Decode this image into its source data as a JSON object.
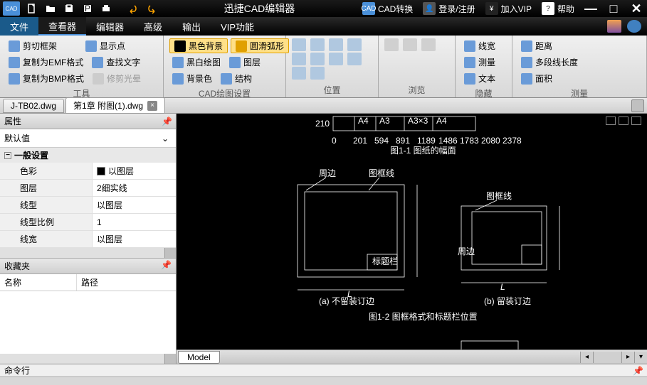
{
  "titlebar": {
    "app_title": "迅捷CAD编辑器",
    "cad_convert": "CAD转换",
    "login": "登录/注册",
    "vip": "加入VIP",
    "help": "帮助"
  },
  "menu": {
    "file": "文件",
    "viewer": "查看器",
    "editor": "编辑器",
    "advanced": "高级",
    "output": "输出",
    "vip_fn": "VIP功能"
  },
  "ribbon": {
    "tools": {
      "clip_frame": "剪切框架",
      "copy_emf": "复制为EMF格式",
      "copy_bmp": "复制为BMP格式",
      "show_points": "显示点",
      "find_text": "查找文字",
      "repair_halo": "修剪光晕",
      "label": "工具"
    },
    "cad_draw": {
      "black_bg": "黑色背景",
      "smooth_arc": "圆滑弧形",
      "bw_draw": "黑白绘图",
      "layers": "图层",
      "bg_color": "背景色",
      "structure": "结构",
      "label": "CAD绘图设置"
    },
    "position": {
      "label": "位置"
    },
    "browse": {
      "label": "浏览"
    },
    "hide": {
      "linewidth": "线宽",
      "measure": "测量",
      "text": "文本",
      "label": "隐藏"
    },
    "measure": {
      "distance": "距离",
      "polyline_len": "多段线长度",
      "area": "面积",
      "label": "测量"
    }
  },
  "doctabs": {
    "tab1": "J-TB02.dwg",
    "tab2": "第1章 附图(1).dwg"
  },
  "props": {
    "title": "属性",
    "default_val": "默认值",
    "general": "一般设置",
    "color_k": "色彩",
    "color_v": "以图层",
    "layer_k": "图层",
    "layer_v": "2细实线",
    "linetype_k": "线型",
    "linetype_v": "以图层",
    "scale_k": "线型比例",
    "scale_v": "1",
    "lw_k": "线宽",
    "lw_v": "以图层"
  },
  "fav": {
    "title": "收藏夹",
    "col_name": "名称",
    "col_path": "路径"
  },
  "canvas": {
    "model": "Model",
    "top_nums": [
      "210",
      "A4",
      "A3",
      "A3×3",
      "A4"
    ],
    "ruler_vals": [
      "0",
      "201",
      "594",
      "891",
      "1189",
      "1486",
      "1783",
      "2080",
      "2378"
    ],
    "fig11": "图1-1 图纸的幅面",
    "zhoubian": "周边",
    "tukuangxian": "图框线",
    "biaotilan": "标题栏",
    "fig_a": "(a) 不留装订边",
    "fig_b": "(b) 留装订边",
    "fig12": "图1-2 图框格式和标题栏位置"
  },
  "cmd": {
    "label": "命令行"
  }
}
